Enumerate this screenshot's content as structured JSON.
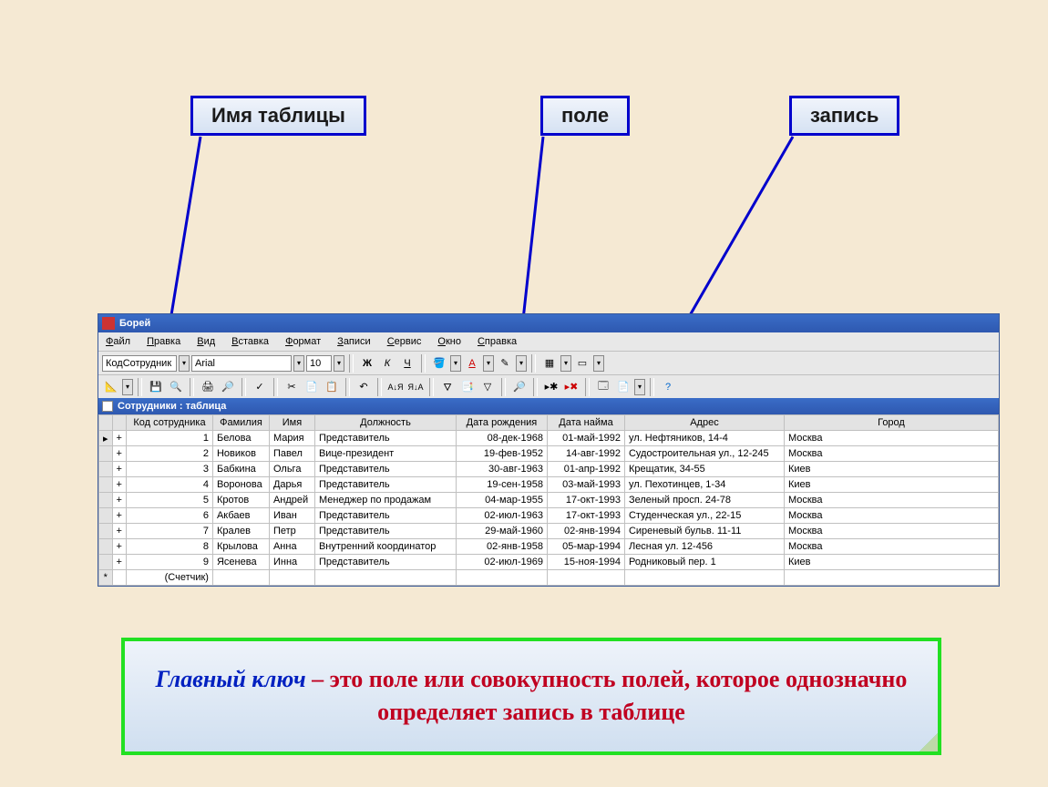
{
  "callouts": {
    "table_name": "Имя таблицы",
    "field": "поле",
    "record": "запись"
  },
  "window": {
    "title": "Борей",
    "menu": [
      "Файл",
      "Правка",
      "Вид",
      "Вставка",
      "Формат",
      "Записи",
      "Сервис",
      "Окно",
      "Справка"
    ],
    "toolbar_format": {
      "field_selector": "КодСотрудник",
      "font": "Arial",
      "size": "10"
    }
  },
  "datasheet": {
    "title": "Сотрудники : таблица",
    "columns": [
      "Код сотрудника",
      "Фамилия",
      "Имя",
      "Должность",
      "Дата рождения",
      "Дата найма",
      "Адрес",
      "Город"
    ],
    "rows": [
      {
        "id": "1",
        "ln": "Белова",
        "fn": "Мария",
        "pos": "Представитель",
        "bd": "08-дек-1968",
        "hd": "01-май-1992",
        "addr": "ул. Нефтяников, 14-4",
        "city": "Москва"
      },
      {
        "id": "2",
        "ln": "Новиков",
        "fn": "Павел",
        "pos": "Вице-президент",
        "bd": "19-фев-1952",
        "hd": "14-авг-1992",
        "addr": "Судостроительная ул., 12-245",
        "city": "Москва"
      },
      {
        "id": "3",
        "ln": "Бабкина",
        "fn": "Ольга",
        "pos": "Представитель",
        "bd": "30-авг-1963",
        "hd": "01-апр-1992",
        "addr": "Крещатик, 34-55",
        "city": "Киев"
      },
      {
        "id": "4",
        "ln": "Воронова",
        "fn": "Дарья",
        "pos": "Представитель",
        "bd": "19-сен-1958",
        "hd": "03-май-1993",
        "addr": "ул. Пехотинцев, 1-34",
        "city": "Киев"
      },
      {
        "id": "5",
        "ln": "Кротов",
        "fn": "Андрей",
        "pos": "Менеджер по продажам",
        "bd": "04-мар-1955",
        "hd": "17-окт-1993",
        "addr": "Зеленый просп. 24-78",
        "city": "Москва"
      },
      {
        "id": "6",
        "ln": "Акбаев",
        "fn": "Иван",
        "pos": "Представитель",
        "bd": "02-июл-1963",
        "hd": "17-окт-1993",
        "addr": "Студенческая ул., 22-15",
        "city": "Москва"
      },
      {
        "id": "7",
        "ln": "Кралев",
        "fn": "Петр",
        "pos": "Представитель",
        "bd": "29-май-1960",
        "hd": "02-янв-1994",
        "addr": "Сиреневый бульв. 11-11",
        "city": "Москва"
      },
      {
        "id": "8",
        "ln": "Крылова",
        "fn": "Анна",
        "pos": "Внутренний координатор",
        "bd": "02-янв-1958",
        "hd": "05-мар-1994",
        "addr": "Лесная ул. 12-456",
        "city": "Москва"
      },
      {
        "id": "9",
        "ln": "Ясенева",
        "fn": "Инна",
        "pos": "Представитель",
        "bd": "02-июл-1969",
        "hd": "15-ноя-1994",
        "addr": "Родниковый пер. 1",
        "city": "Киев"
      }
    ],
    "new_row_placeholder": "(Счетчик)"
  },
  "info_panel": {
    "term": "Главный ключ",
    "sep": " – ",
    "text": "это поле или совокупность полей, которое однозначно определяет запись в таблице"
  }
}
